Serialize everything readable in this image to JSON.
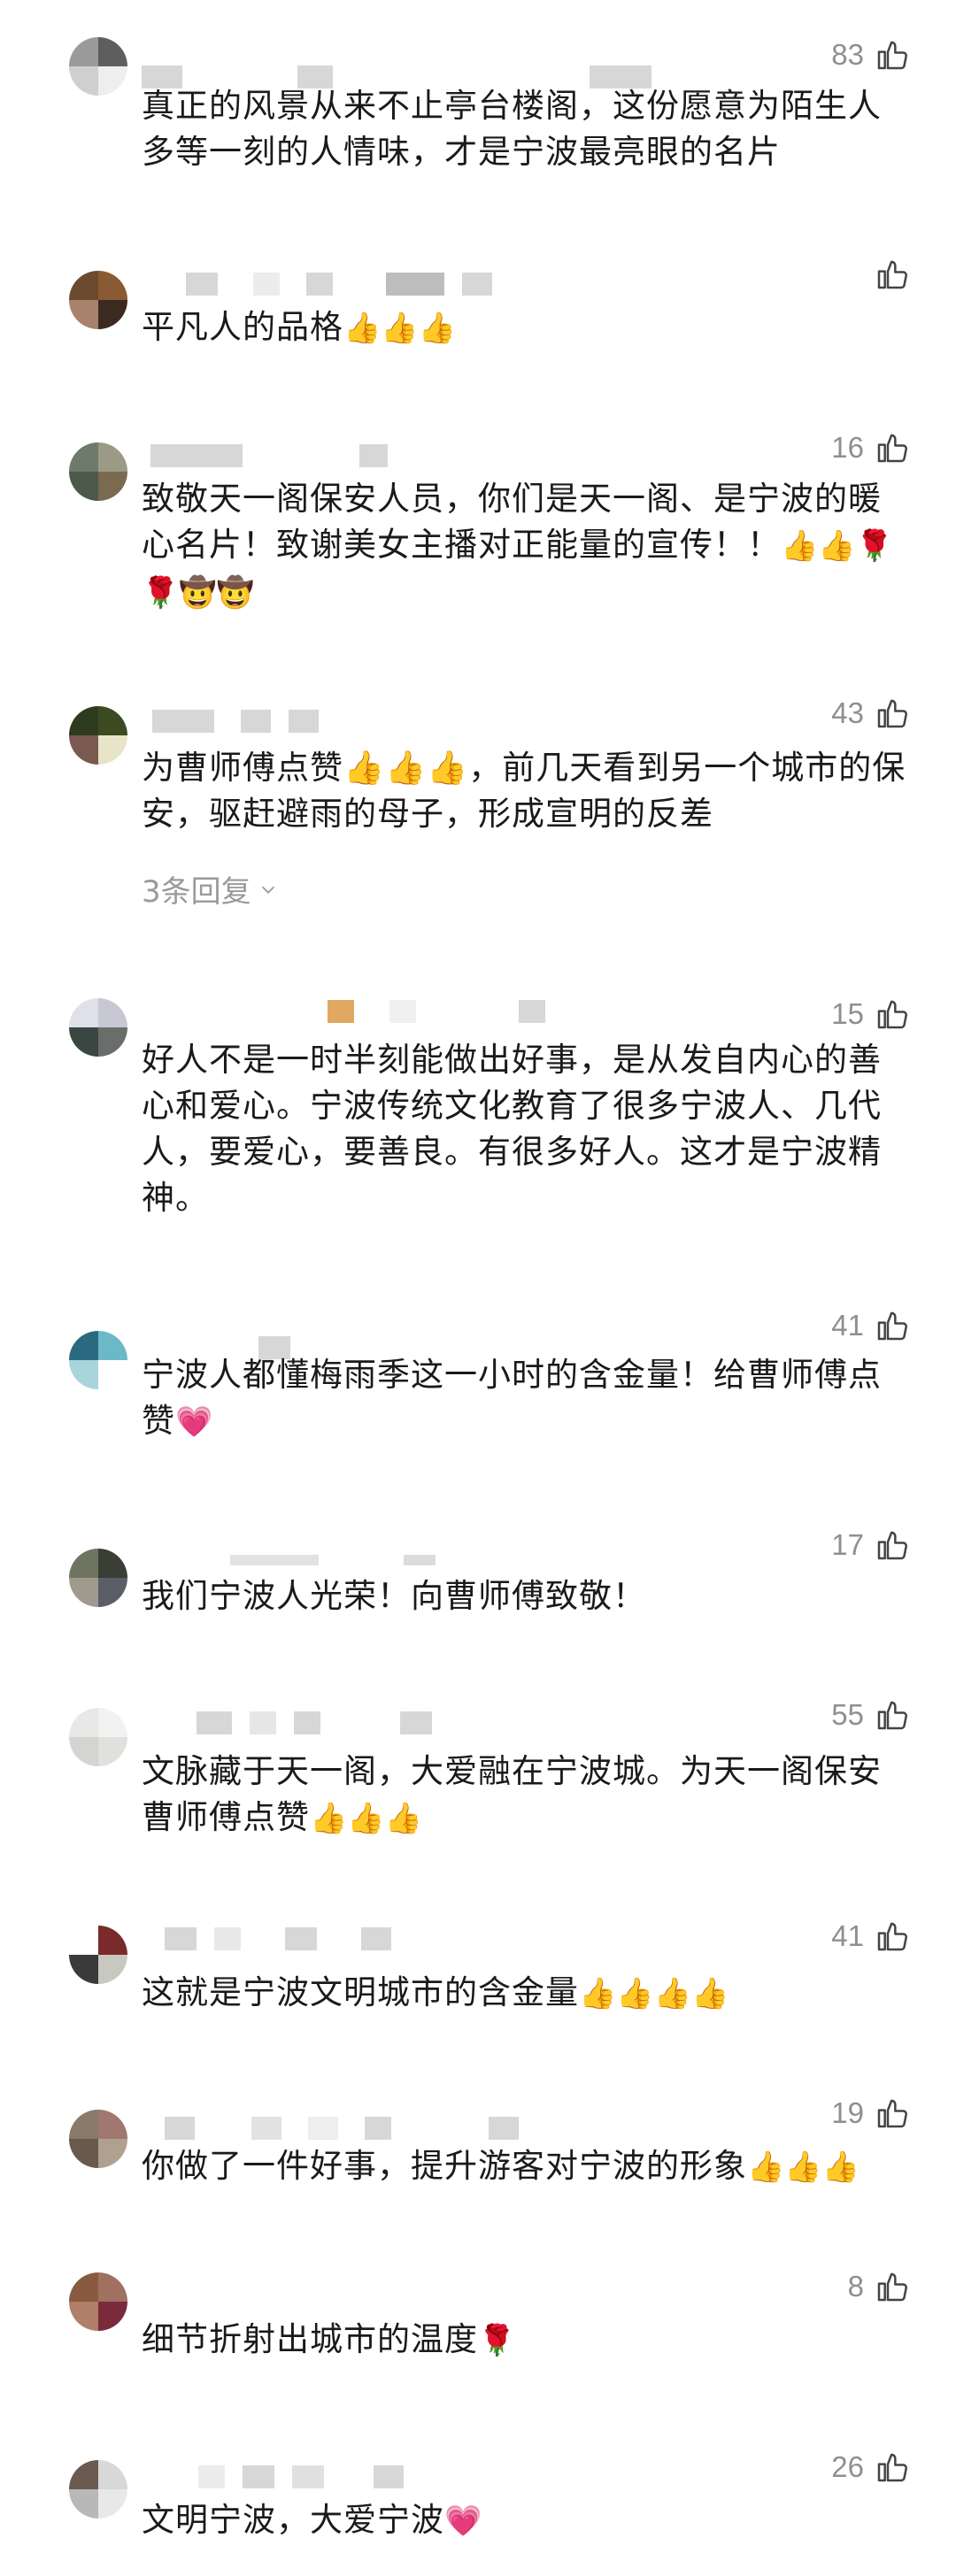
{
  "comments": [
    {
      "text": "真正的风景从来不止亭台楼阁，这份愿意为陌生人多等一刻的人情味，才是宁波最亮眼的名片",
      "emoji": "",
      "likes": "83"
    },
    {
      "text": "平凡人的品格",
      "emoji": "👍👍👍",
      "likes": ""
    },
    {
      "text": "致敬天一阁保安人员，你们是天一阁、是宁波的暖心名片！致谢美女主播对正能量的宣传！！",
      "emoji": "👍👍🌹🌹🤠🤠",
      "likes": "16"
    },
    {
      "text": "为曹师傅点赞👍👍👍，前几天看到另一个城市的保安，驱赶避雨的母子，形成宣明的反差",
      "emoji": "",
      "likes": "43",
      "replies": "3条回复"
    },
    {
      "text": "好人不是一时半刻能做出好事，是从发自内心的善心和爱心。宁波传统文化教育了很多宁波人、几代人，要爱心，要善良。有很多好人。这才是宁波精神。",
      "emoji": "",
      "likes": "15"
    },
    {
      "text": "宁波人都懂梅雨季这一小时的含金量！给曹师傅点赞",
      "emoji": "💗",
      "likes": "41"
    },
    {
      "text": "我们宁波人光荣！向曹师傅致敬！",
      "emoji": "",
      "likes": "17"
    },
    {
      "text": "文脉藏于天一阁，大爱融在宁波城。为天一阁保安曹师傅点赞",
      "emoji": "👍👍👍",
      "likes": "55"
    },
    {
      "text": "这就是宁波文明城市的含金量",
      "emoji": "👍👍👍👍",
      "likes": "41"
    },
    {
      "text": "你做了一件好事，提升游客对宁波的形象",
      "emoji": "👍👍👍",
      "likes": "19"
    },
    {
      "text": "细节折射出城市的温度",
      "emoji": "🌹",
      "likes": "8"
    },
    {
      "text": "文明宁波，大爱宁波",
      "emoji": "💗",
      "likes": "26"
    }
  ]
}
